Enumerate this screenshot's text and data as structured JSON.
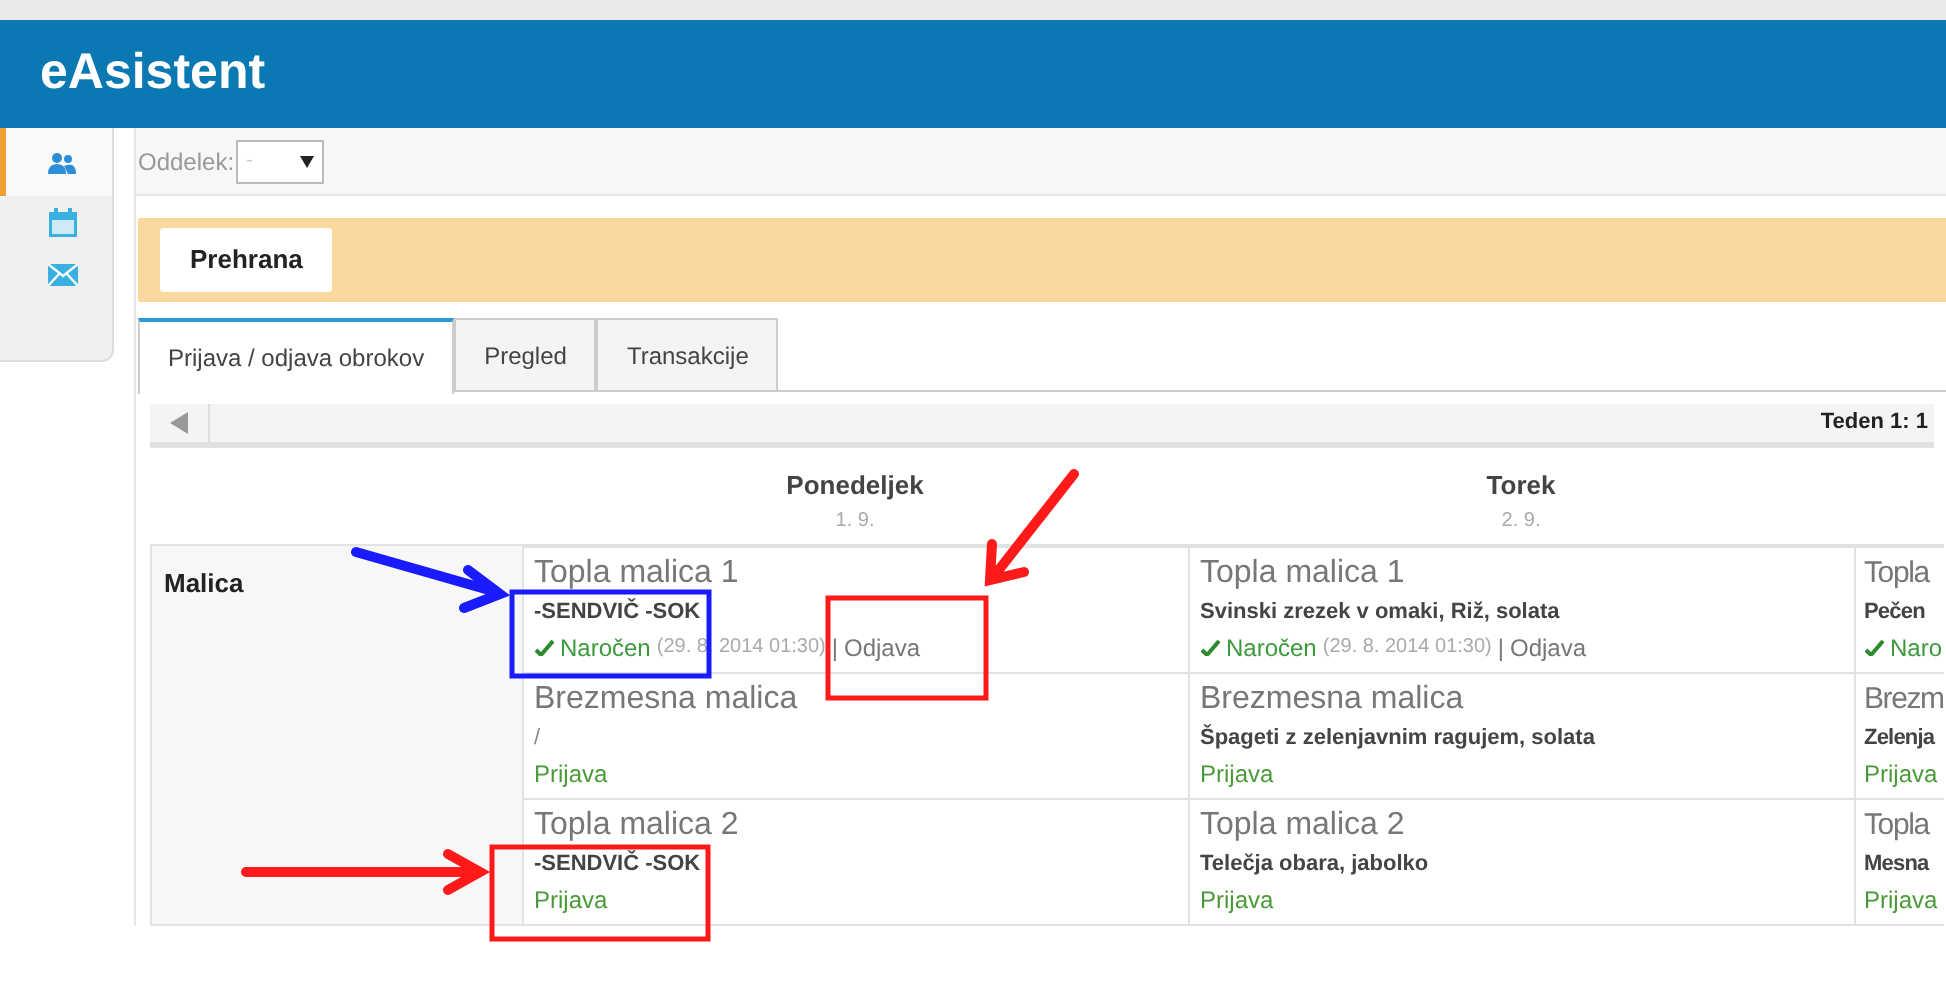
{
  "app": {
    "title": "eAsistent"
  },
  "sidebar": {
    "items": [
      {
        "kind": "people",
        "selected": true
      },
      {
        "kind": "calendar",
        "selected": false
      },
      {
        "kind": "mail",
        "selected": false
      }
    ]
  },
  "filter": {
    "label": "Oddelek:",
    "value": "-"
  },
  "section": {
    "title": "Prehrana"
  },
  "tabs": [
    {
      "label": "Prijava / odjava obrokov",
      "selected": true
    },
    {
      "label": "Pregled",
      "selected": false
    },
    {
      "label": "Transakcije",
      "selected": false
    }
  ],
  "pager": {
    "week": "Teden 1: 1"
  },
  "days": [
    {
      "name": "Ponedeljek",
      "date": "1. 9."
    },
    {
      "name": "Torek",
      "date": "2. 9."
    }
  ],
  "meal": {
    "label": "Malica",
    "rows": [
      {
        "cells": [
          {
            "title": "Topla malica 1",
            "dish": "-SENDVIČ -SOK",
            "kind": "ordered",
            "status": "Naročen",
            "timestamp": "(29. 8. 2014 01:30)",
            "separator": "|",
            "action": "Odjava"
          },
          {
            "title": "Topla malica 1",
            "dish": "Svinski zrezek v omaki, Riž, solata",
            "kind": "ordered",
            "status": "Naročen",
            "timestamp": "(29. 8. 2014 01:30)",
            "separator": "|",
            "action": "Odjava"
          },
          {
            "title": "Topla",
            "dish": "Pečen",
            "kind": "ordered",
            "status": "Naro"
          }
        ]
      },
      {
        "cells": [
          {
            "title": "Brezmesna malica",
            "dish": "/",
            "dish_plain": true,
            "kind": "available",
            "action": "Prijava"
          },
          {
            "title": "Brezmesna malica",
            "dish": "Špageti z zelenjavnim ragujem, solata",
            "kind": "available",
            "action": "Prijava"
          },
          {
            "title": "Brezm",
            "dish": "Zelenja",
            "kind": "available",
            "action": "Prijava"
          }
        ]
      },
      {
        "cells": [
          {
            "title": "Topla malica 2",
            "dish": "-SENDVIČ -SOK",
            "kind": "available",
            "action": "Prijava"
          },
          {
            "title": "Topla malica 2",
            "dish": "Telečja obara, jabolko",
            "kind": "available",
            "action": "Prijava"
          },
          {
            "title": "Topla",
            "dish": "Mesna",
            "kind": "available",
            "action": "Prijava"
          }
        ]
      }
    ]
  },
  "annotations": [
    {
      "kind": "arrow",
      "color": "#1a1aff"
    },
    {
      "kind": "box",
      "color": "#1a1aff"
    },
    {
      "kind": "arrow",
      "color": "#ff1a1a"
    },
    {
      "kind": "box",
      "color": "#ff1a1a"
    },
    {
      "kind": "arrow",
      "color": "#ff1a1a"
    },
    {
      "kind": "box",
      "color": "#ff1a1a"
    }
  ]
}
